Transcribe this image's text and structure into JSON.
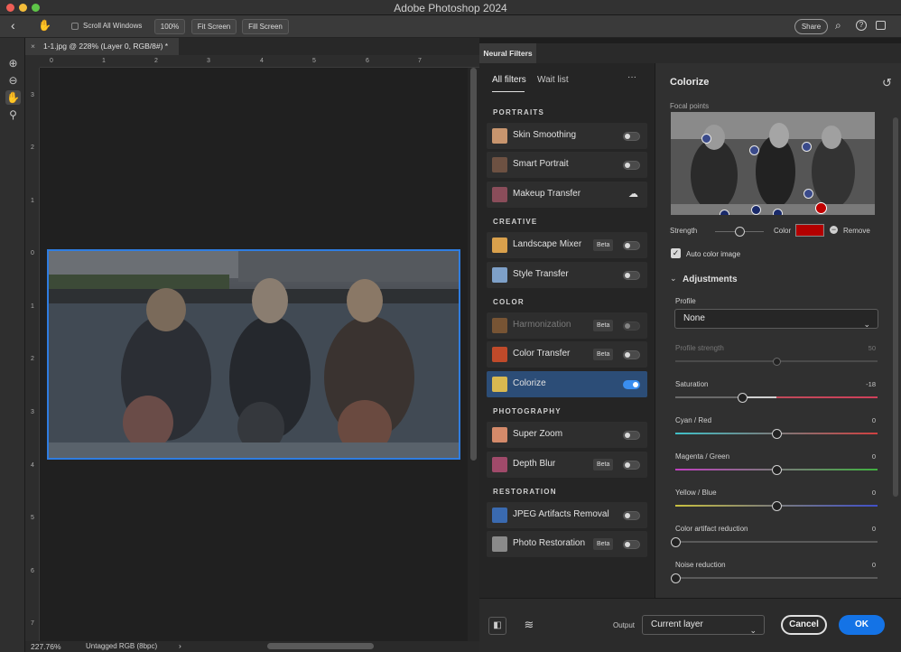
{
  "app": {
    "title": "Adobe Photoshop 2024"
  },
  "options_bar": {
    "scroll_all_windows": "Scroll All Windows",
    "zoom_100": "100%",
    "fit_screen": "Fit Screen",
    "fill_screen": "Fill Screen",
    "share": "Share"
  },
  "document": {
    "tab_title": "1-1.jpg @ 228% (Layer 0, RGB/8#) *",
    "zoom": "227.76%",
    "color_profile": "Untagged RGB (8bpc)"
  },
  "rulers": {
    "horizontal": [
      "0",
      "1",
      "2",
      "3",
      "4",
      "5",
      "6",
      "7"
    ],
    "vertical": [
      "3",
      "2",
      "1",
      "0",
      "1",
      "2",
      "3",
      "4",
      "5",
      "6",
      "7"
    ]
  },
  "neural_filters": {
    "panel_title": "Neural Filters",
    "tabs": [
      "All filters",
      "Wait list"
    ],
    "more": "···",
    "groups": [
      {
        "label": "PORTRAITS",
        "filters": [
          {
            "name": "Skin Smoothing",
            "beta": "",
            "state": "off"
          },
          {
            "name": "Smart Portrait",
            "beta": "",
            "state": "off"
          },
          {
            "name": "Makeup Transfer",
            "beta": "",
            "state": "cloud"
          }
        ]
      },
      {
        "label": "CREATIVE",
        "filters": [
          {
            "name": "Landscape Mixer",
            "beta": "Beta",
            "state": "off"
          },
          {
            "name": "Style Transfer",
            "beta": "",
            "state": "off"
          }
        ]
      },
      {
        "label": "COLOR",
        "filters": [
          {
            "name": "Harmonization",
            "beta": "Beta",
            "state": "disabled"
          },
          {
            "name": "Color Transfer",
            "beta": "Beta",
            "state": "off"
          },
          {
            "name": "Colorize",
            "beta": "",
            "state": "on"
          }
        ]
      },
      {
        "label": "PHOTOGRAPHY",
        "filters": [
          {
            "name": "Super Zoom",
            "beta": "",
            "state": "off"
          },
          {
            "name": "Depth Blur",
            "beta": "Beta",
            "state": "off"
          }
        ]
      },
      {
        "label": "RESTORATION",
        "filters": [
          {
            "name": "JPEG Artifacts Removal",
            "beta": "",
            "state": "off"
          },
          {
            "name": "Photo Restoration",
            "beta": "Beta",
            "state": "off"
          }
        ]
      }
    ]
  },
  "colorize": {
    "title": "Colorize",
    "focal_points_label": "Focal points",
    "strength_label": "Strength",
    "strength_value": 0.5,
    "color_label": "Color",
    "color_swatch": "#b30000",
    "remove_label": "Remove",
    "auto_color_label": "Auto color image",
    "auto_color_checked": true,
    "adjustments_label": "Adjustments",
    "profile_label": "Profile",
    "profile_value": "None",
    "sliders": [
      {
        "label": "Profile strength",
        "value": "50",
        "level": 0.5,
        "disabled": true
      },
      {
        "label": "Saturation",
        "value": "-18",
        "level": 0.33,
        "gradient": "sat"
      },
      {
        "label": "Cyan / Red",
        "value": "0",
        "level": 0.5,
        "gradient": "cr"
      },
      {
        "label": "Magenta / Green",
        "value": "0",
        "level": 0.5,
        "gradient": "mg"
      },
      {
        "label": "Yellow / Blue",
        "value": "0",
        "level": 0.5,
        "gradient": "yb"
      },
      {
        "label": "Color artifact reduction",
        "value": "0",
        "level": 0.0
      },
      {
        "label": "Noise reduction",
        "value": "0",
        "level": 0.0
      }
    ]
  },
  "footer": {
    "output_label": "Output",
    "output_value": "Current layer",
    "cancel": "Cancel",
    "ok": "OK"
  },
  "colors": {
    "accent": "#2f7de1",
    "ok_button": "#1473e6",
    "selected_row": "#2c4d77"
  }
}
